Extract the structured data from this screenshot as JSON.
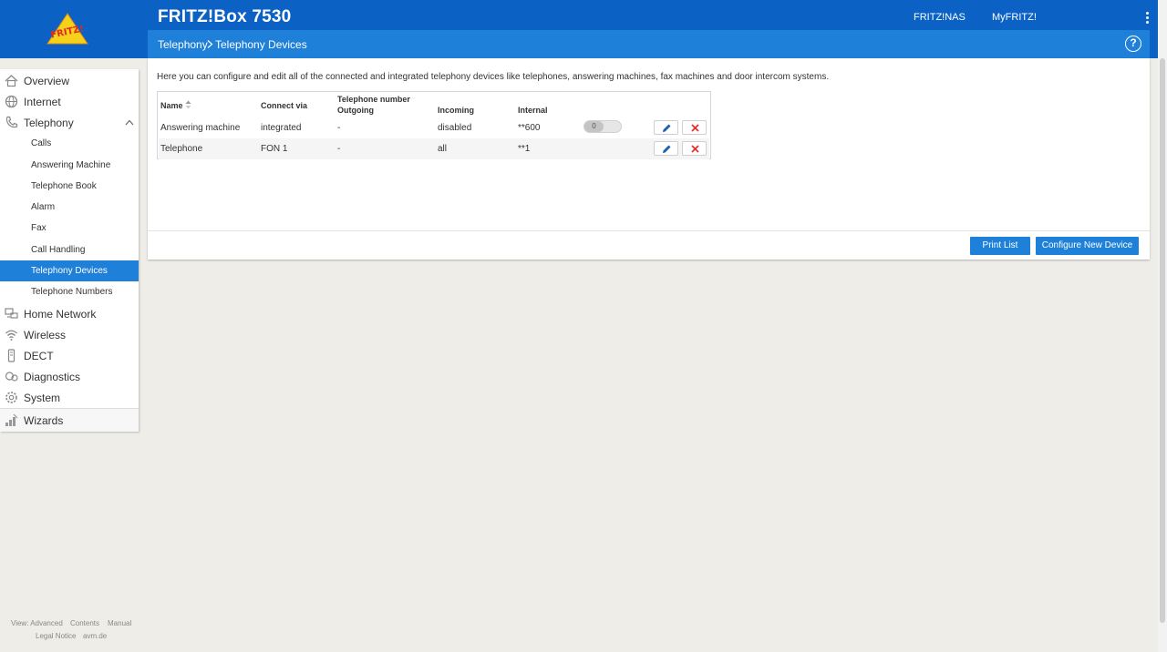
{
  "header": {
    "product_title": "FRITZ!Box 7530",
    "links": [
      "FRITZ!NAS",
      "MyFRITZ!"
    ],
    "logo_text": "FRITZ!"
  },
  "breadcrumb": {
    "parent": "Telephony",
    "current": "Telephony Devices",
    "help_symbol": "?"
  },
  "sidebar": {
    "items": [
      {
        "label": "Overview",
        "icon": "home-icon"
      },
      {
        "label": "Internet",
        "icon": "globe-icon"
      },
      {
        "label": "Telephony",
        "icon": "phone-icon"
      },
      {
        "label": "Home Network",
        "icon": "network-icon"
      },
      {
        "label": "Wireless",
        "icon": "wifi-icon"
      },
      {
        "label": "DECT",
        "icon": "dect-icon"
      },
      {
        "label": "Diagnostics",
        "icon": "diagnostics-icon"
      },
      {
        "label": "System",
        "icon": "system-icon"
      },
      {
        "label": "Wizards",
        "icon": "wizards-icon"
      }
    ],
    "telephony_sub": [
      "Calls",
      "Answering Machine",
      "Telephone Book",
      "Alarm",
      "Fax",
      "Call Handling",
      "Telephony Devices",
      "Telephone Numbers"
    ],
    "active_sub": "Telephony Devices"
  },
  "footer": {
    "view": "View: Advanced",
    "contents": "Contents",
    "manual": "Manual",
    "legal": "Legal Notice",
    "avm": "avm.de"
  },
  "main": {
    "intro": "Here you can configure and edit all of the connected and integrated telephony devices like telephones, answering machines, fax machines and door intercom systems.",
    "table": {
      "headers": {
        "name": "Name",
        "connect_via": "Connect via",
        "telephone_number": "Telephone number",
        "outgoing": "Outgoing",
        "incoming": "Incoming",
        "internal": "Internal"
      },
      "rows": [
        {
          "name": "Answering machine",
          "connect_via": "integrated",
          "outgoing": "-",
          "incoming": "disabled",
          "internal": "**600",
          "toggle": "0"
        },
        {
          "name": "Telephone",
          "connect_via": "FON 1",
          "outgoing": "-",
          "incoming": "all",
          "internal": "**1"
        }
      ]
    },
    "buttons": {
      "print": "Print List",
      "configure": "Configure New Device"
    }
  },
  "colors": {
    "header_blue": "#0b62c4",
    "crumb_blue": "#1f80da",
    "delete_red": "#e5322d",
    "edit_blue": "#1a5fb4"
  }
}
